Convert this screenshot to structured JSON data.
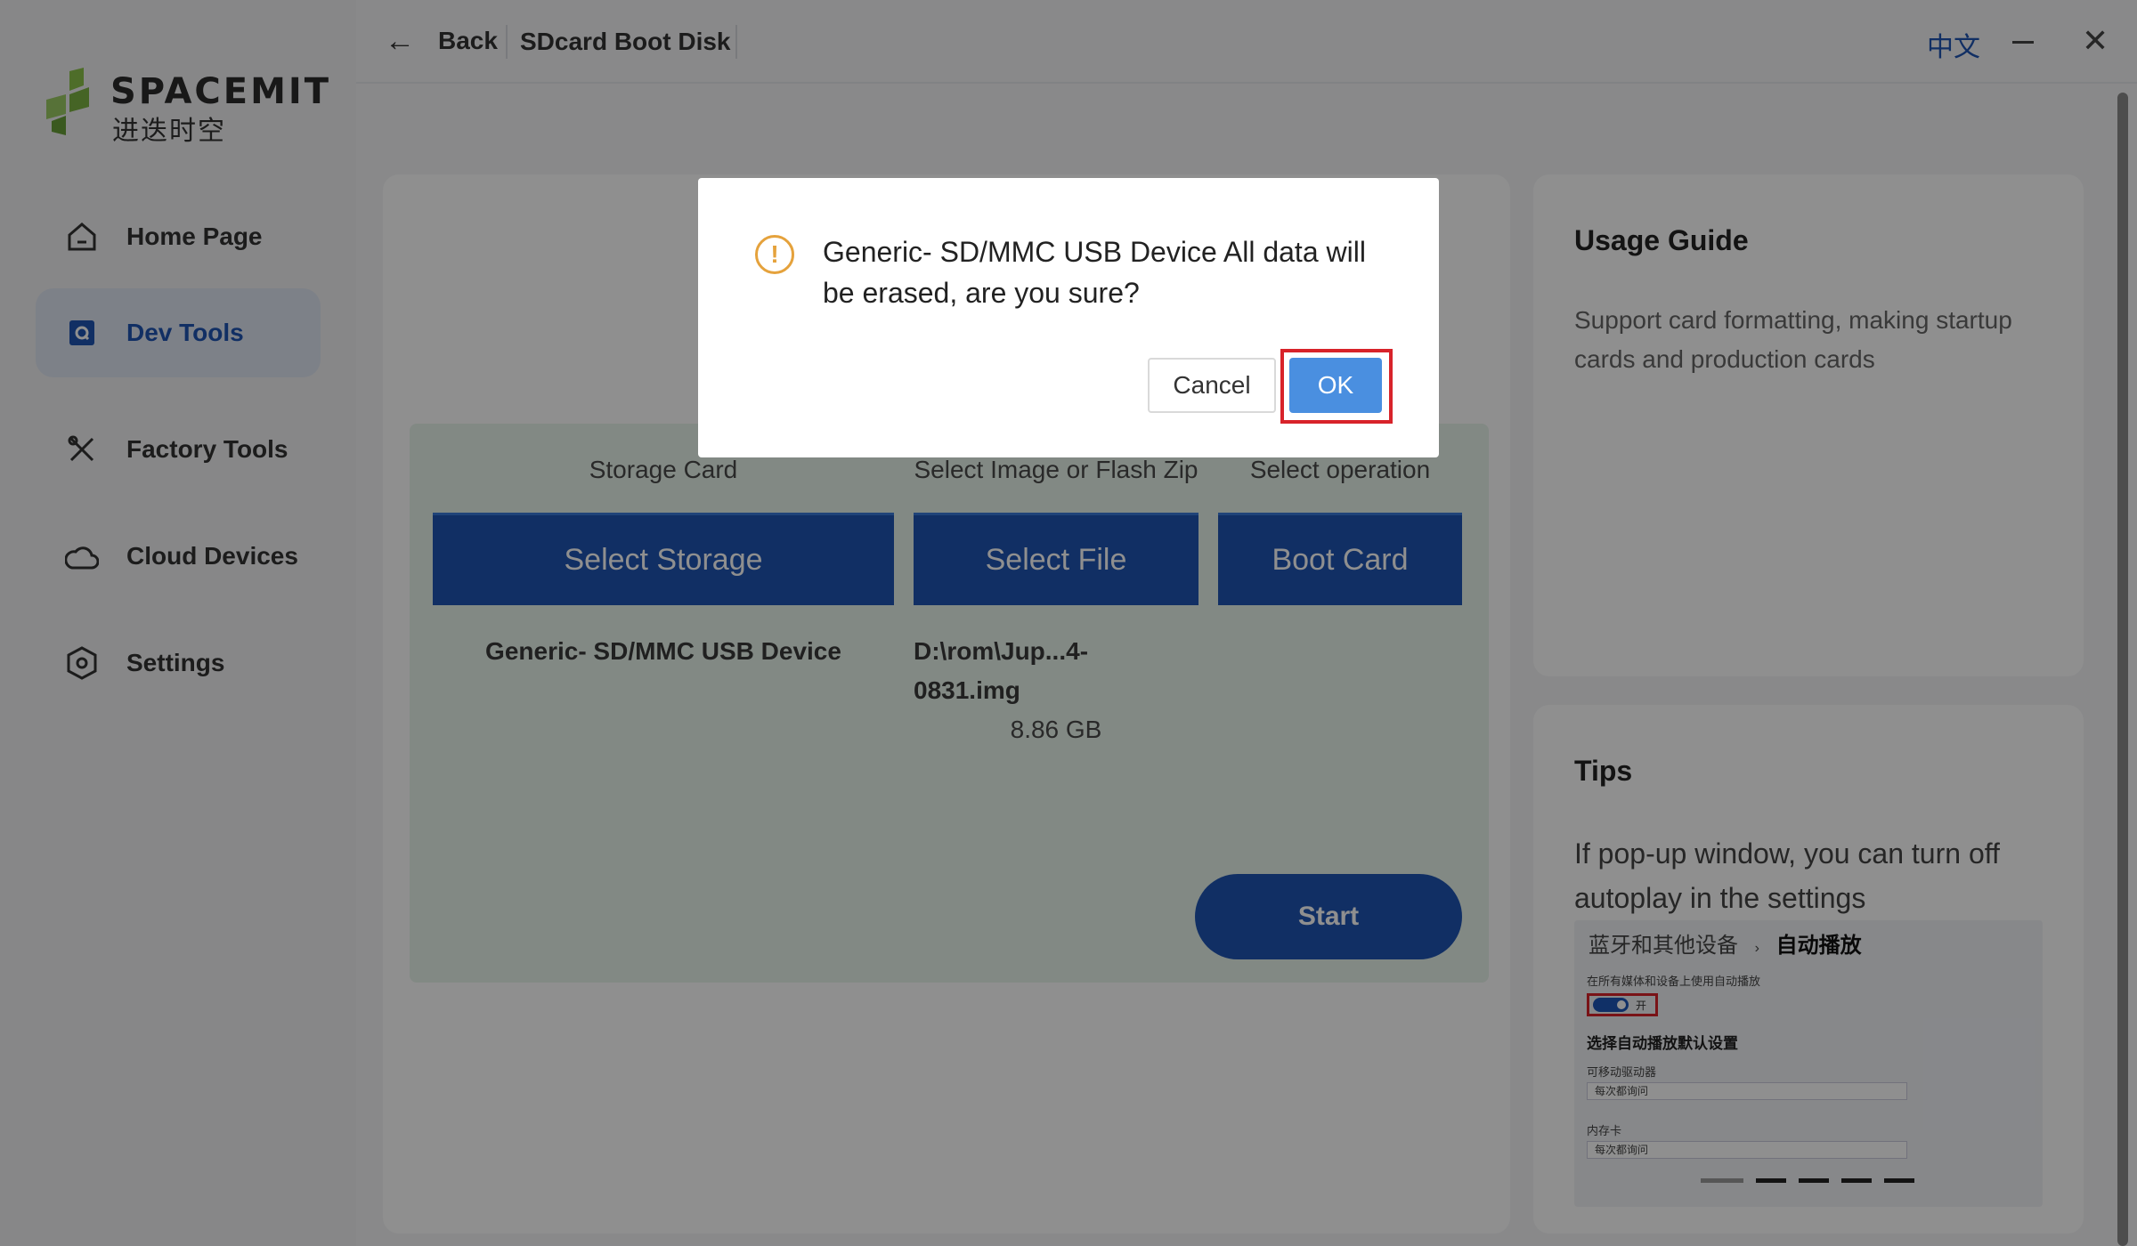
{
  "app": {
    "logo_text": "SPACEMIT",
    "logo_sub": "进迭时空"
  },
  "sidebar": {
    "items": [
      {
        "label": "Home Page",
        "icon": "home-icon"
      },
      {
        "label": "Dev Tools",
        "icon": "dev-tools-icon",
        "active": true
      },
      {
        "label": "Factory Tools",
        "icon": "tools-icon"
      },
      {
        "label": "Cloud Devices",
        "icon": "cloud-icon"
      },
      {
        "label": "Settings",
        "icon": "settings-icon"
      }
    ]
  },
  "topbar": {
    "back_label": "Back",
    "page_title": "SDcard Boot Disk",
    "language": "中文"
  },
  "main": {
    "columns": [
      {
        "heading": "Storage Card",
        "button": "Select Storage"
      },
      {
        "heading": "Select Image or Flash Zip",
        "button": "Select File"
      },
      {
        "heading": "Select operation",
        "button": "Boot Card"
      }
    ],
    "selected_storage": "Generic- SD/MMC USB Device",
    "selected_file_line1": "D:\\rom\\Jup...4-",
    "selected_file_line2": "0831.img",
    "file_size": "8.86 GB",
    "start_label": "Start"
  },
  "guide": {
    "title": "Usage Guide",
    "description": "Support card formatting, making startup cards and production cards"
  },
  "tips": {
    "title": "Tips",
    "description": "If pop-up window, you can turn off autoplay in the settings",
    "screenshot": {
      "breadcrumb_parent": "蓝牙和其他设备",
      "breadcrumb_sep": "›",
      "breadcrumb_current": "自动播放",
      "toggle_caption": "在所有媒体和设备上使用自动播放",
      "toggle_state": "开",
      "heading": "选择自动播放默认设置",
      "removable_label": "可移动驱动器",
      "removable_value": "每次都询问",
      "memory_label": "内存卡",
      "memory_value": "每次都询问"
    }
  },
  "dialog": {
    "message": "Generic- SD/MMC USB Device All data will be erased, are you sure?",
    "cancel_label": "Cancel",
    "ok_label": "OK",
    "icon": "warning-icon"
  },
  "colors": {
    "accent": "#1f54b3",
    "panel": "#e8f4ec",
    "warning": "#e5a23c",
    "highlight": "#d8232a",
    "ok_button": "#4a8fe0"
  }
}
